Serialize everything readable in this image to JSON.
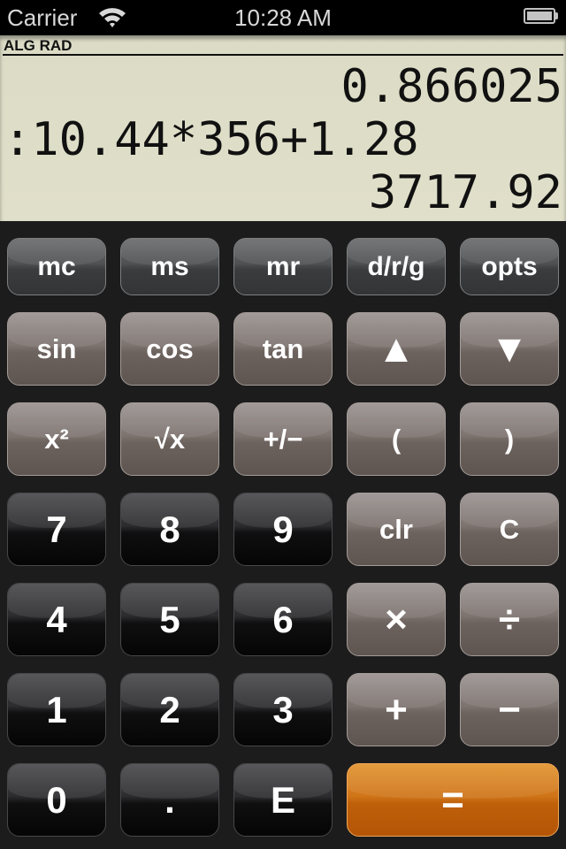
{
  "status_bar": {
    "carrier": "Carrier",
    "wifi_icon": "wifi-icon",
    "time": "10:28 AM",
    "battery_icon": "battery-icon",
    "battery_level": 1.0
  },
  "display": {
    "mode": "ALG RAD",
    "line1": "0.866025",
    "line2": ":10.44*356+1.28",
    "line3": "3717.92",
    "background": "#dedcc8"
  },
  "keypad": {
    "accent_color": "#cf7418",
    "rows": [
      [
        {
          "label": "mc",
          "name": "memory-clear"
        },
        {
          "label": "ms",
          "name": "memory-store"
        },
        {
          "label": "mr",
          "name": "memory-recall"
        },
        {
          "label": "d/r/g",
          "name": "angle-mode"
        },
        {
          "label": "opts",
          "name": "options"
        }
      ],
      [
        {
          "label": "sin",
          "name": "sin"
        },
        {
          "label": "cos",
          "name": "cos"
        },
        {
          "label": "tan",
          "name": "tan"
        },
        {
          "label": "▲",
          "name": "scroll-up",
          "icon": "triangle-up-icon"
        },
        {
          "label": "▼",
          "name": "scroll-down",
          "icon": "triangle-down-icon"
        }
      ],
      [
        {
          "label": "x²",
          "name": "square"
        },
        {
          "label": "√x",
          "name": "square-root"
        },
        {
          "label": "+/−",
          "name": "negate"
        },
        {
          "label": "(",
          "name": "open-paren"
        },
        {
          "label": ")",
          "name": "close-paren"
        }
      ],
      [
        {
          "label": "7",
          "name": "digit-7"
        },
        {
          "label": "8",
          "name": "digit-8"
        },
        {
          "label": "9",
          "name": "digit-9"
        },
        {
          "label": "clr",
          "name": "clear-all"
        },
        {
          "label": "C",
          "name": "clear-entry"
        }
      ],
      [
        {
          "label": "4",
          "name": "digit-4"
        },
        {
          "label": "5",
          "name": "digit-5"
        },
        {
          "label": "6",
          "name": "digit-6"
        },
        {
          "label": "×",
          "name": "multiply"
        },
        {
          "label": "÷",
          "name": "divide"
        }
      ],
      [
        {
          "label": "1",
          "name": "digit-1"
        },
        {
          "label": "2",
          "name": "digit-2"
        },
        {
          "label": "3",
          "name": "digit-3"
        },
        {
          "label": "+",
          "name": "add"
        },
        {
          "label": "−",
          "name": "subtract"
        }
      ],
      [
        {
          "label": "0",
          "name": "digit-0"
        },
        {
          "label": ".",
          "name": "decimal-point"
        },
        {
          "label": "E",
          "name": "exponent"
        },
        {
          "label": "=",
          "name": "equals"
        }
      ]
    ]
  }
}
